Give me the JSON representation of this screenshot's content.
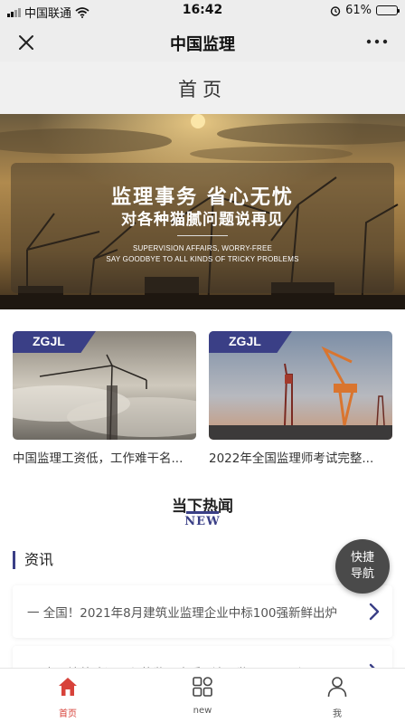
{
  "status_bar": {
    "carrier": "中国联通",
    "time": "16:42",
    "battery": "61%",
    "battery_level": 0.61
  },
  "nav": {
    "title": "中国监理",
    "close_icon": "close-icon",
    "more_icon": "more-icon"
  },
  "page_header": {
    "title": "首页"
  },
  "banner": {
    "headline": "监理事务 省心无忧",
    "subline": "对各种猫腻问题说再见",
    "english_line1": "SUPERVISION AFFAIRS, WORRY-FREE",
    "english_line2": "SAY GOODBYE TO ALL KINDS OF TRICKY PROBLEMS"
  },
  "cards": [
    {
      "tag": "ZGJL",
      "title": "中国监理工资低，工作难干名..."
    },
    {
      "tag": "ZGJL",
      "title": "2022年全国监理师考试完整..."
    }
  ],
  "hot": {
    "title": "当下热闻",
    "subtitle": "NEW"
  },
  "news": {
    "heading": "资讯",
    "items": [
      {
        "text": "一 全国！2021年8月建筑业监理企业中标100强新鲜出炉"
      },
      {
        "text": "一 中国境外建设工程的监理查兵 “沈阳监理” 双工程同"
      }
    ]
  },
  "quick_nav": {
    "line1": "快捷",
    "line2": "导航"
  },
  "tab_bar": {
    "items": [
      {
        "label": "首页",
        "icon": "home-icon",
        "active": true
      },
      {
        "label": "new",
        "icon": "grid-icon",
        "active": false
      },
      {
        "label": "我",
        "icon": "person-icon",
        "active": false
      }
    ]
  },
  "colors": {
    "accent": "#3a3f86",
    "active_tab": "#d7423a"
  }
}
